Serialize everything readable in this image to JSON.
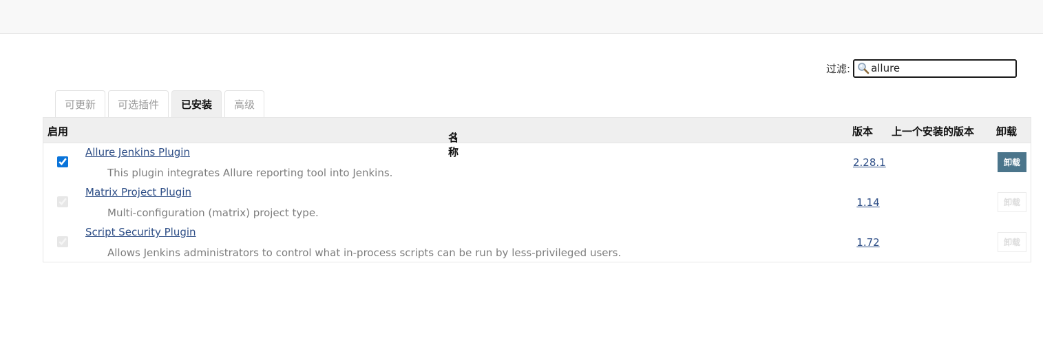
{
  "filter": {
    "label": "过滤:",
    "value": "allure"
  },
  "tabs": [
    {
      "label": "可更新",
      "active": false
    },
    {
      "label": "可选插件",
      "active": false
    },
    {
      "label": "已安装",
      "active": true
    },
    {
      "label": "高级",
      "active": false
    }
  ],
  "table": {
    "headers": {
      "enabled": "启用",
      "name": "名称",
      "sort_indicator": "↓",
      "version": "版本",
      "previous_version": "上一个安装的版本",
      "uninstall": "卸载"
    },
    "rows": [
      {
        "enabled": true,
        "editable": true,
        "name": "Allure Jenkins Plugin",
        "description": "This plugin integrates Allure reporting tool into Jenkins.",
        "version": "2.28.1",
        "previous_version": "",
        "uninstall_label": "卸载",
        "uninstall_enabled": true
      },
      {
        "enabled": true,
        "editable": false,
        "name": "Matrix Project Plugin",
        "description": "Multi-configuration (matrix) project type.",
        "version": "1.14",
        "previous_version": "",
        "uninstall_label": "卸载",
        "uninstall_enabled": false
      },
      {
        "enabled": true,
        "editable": false,
        "name": "Script Security Plugin",
        "description": "Allows Jenkins administrators to control what in-process scripts can be run by less-privileged users.",
        "version": "1.72",
        "previous_version": "",
        "uninstall_label": "卸载",
        "uninstall_enabled": false
      }
    ]
  },
  "colors": {
    "link": "#2f4f87",
    "uninstall_button": "#4b758b",
    "header_bg": "#efefef",
    "checkbox": "#0a74da"
  },
  "icons": {
    "filter": "search-icon"
  }
}
